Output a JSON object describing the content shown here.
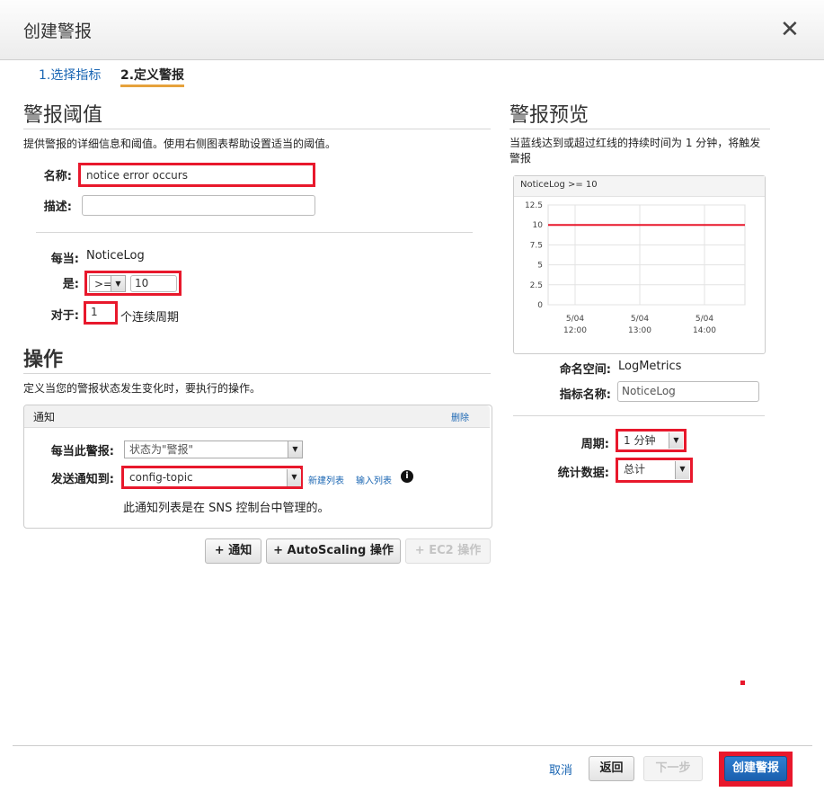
{
  "dialog": {
    "title": "创建警报"
  },
  "steps": [
    {
      "label": "1.选择指标"
    },
    {
      "label": "2.定义警报"
    }
  ],
  "threshold": {
    "heading": "警报阈值",
    "description": "提供警报的详细信息和阈值。使用右侧图表帮助设置适当的阈值。",
    "name_label": "名称:",
    "name_value": "notice error occurs",
    "desc_label": "描述:",
    "desc_value": "",
    "whenever_label": "每当:",
    "metric_name": "NoticeLog",
    "is_label": "是:",
    "operator": ">=",
    "threshold_value": "10",
    "for_label": "对于:",
    "periods_value": "1",
    "periods_suffix": "个连续周期"
  },
  "actions": {
    "heading": "操作",
    "description": "定义当您的警报状态发生变化时，要执行的操作。",
    "panel_title": "通知",
    "delete_label": "删除",
    "whenever_alarm_label": "每当此警报:",
    "state_value": "状态为\"警报\"",
    "send_to_label": "发送通知到:",
    "topic_value": "config-topic",
    "new_list_link": "新建列表",
    "enter_list_link": "输入列表",
    "sns_note": "此通知列表是在 SNS 控制台中管理的。",
    "btn_notification": "+ 通知",
    "btn_autoscaling": "+ AutoScaling 操作",
    "btn_ec2": "+ EC2 操作"
  },
  "preview": {
    "heading": "警报预览",
    "description": "当蓝线达到或超过红线的持续时间为 1 分钟，将触发警报",
    "namespace_label": "命名空间:",
    "namespace_value": "LogMetrics",
    "metric_label": "指标名称:",
    "metric_value": "NoticeLog",
    "period_label": "周期:",
    "period_value": "1 分钟",
    "stat_label": "统计数据:",
    "stat_value": "总计"
  },
  "chart_data": {
    "type": "line",
    "title": "NoticeLog >= 10",
    "y_ticks": [
      "12.5",
      "10",
      "7.5",
      "5",
      "2.5",
      "0"
    ],
    "ylim": [
      0,
      12.5
    ],
    "x_ticks": [
      {
        "date": "5/04",
        "time": "12:00"
      },
      {
        "date": "5/04",
        "time": "13:00"
      },
      {
        "date": "5/04",
        "time": "14:00"
      }
    ],
    "threshold": 10,
    "threshold_color": "#e8182c",
    "grid": true
  },
  "footer": {
    "cancel": "取消",
    "back": "返回",
    "next": "下一步",
    "create": "创建警报"
  },
  "colors": {
    "accent": "#1a66b3",
    "highlight": "#e8182c",
    "tab_underline": "#e6a23c"
  }
}
